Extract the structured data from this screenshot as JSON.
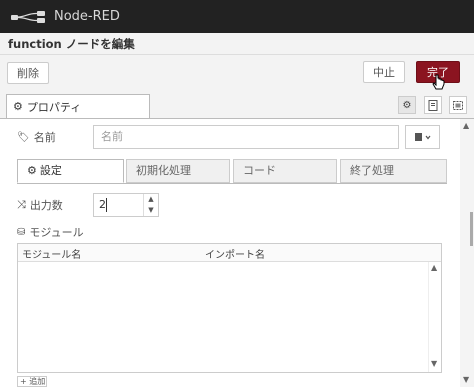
{
  "app": {
    "title": "Node-RED"
  },
  "tray": {
    "title": "function ノードを編集"
  },
  "toolbar": {
    "delete_label": "削除",
    "cancel_label": "中止",
    "done_label": "完了"
  },
  "tabs": {
    "properties_label": "プロパティ"
  },
  "form": {
    "name_label": "名前",
    "name_placeholder": "名前",
    "outputs_label": "出力数",
    "outputs_value": "2",
    "modules_label": "モジュール"
  },
  "subtabs": [
    {
      "label": "設定"
    },
    {
      "label": "初期化処理"
    },
    {
      "label": "コード"
    },
    {
      "label": "終了処理"
    }
  ],
  "modules_table": {
    "col_module": "モジュール名",
    "col_import": "インポート名"
  },
  "add_label": "+ 追加",
  "colors": {
    "accent": "#8b1420",
    "titlebar": "#222222"
  },
  "icons": [
    "node-red-logo-icon",
    "gear-icon",
    "book-icon",
    "appearance-icon",
    "tag-icon",
    "shuffle-icon",
    "cubes-icon",
    "cursor-icon"
  ]
}
